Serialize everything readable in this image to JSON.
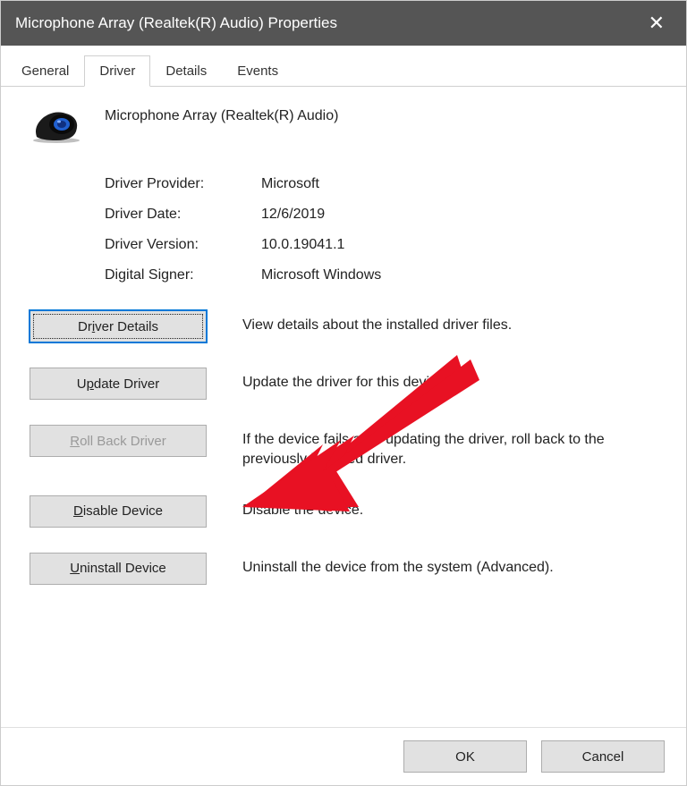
{
  "window": {
    "title": "Microphone Array (Realtek(R) Audio) Properties"
  },
  "tabs": [
    {
      "label": "General",
      "active": false
    },
    {
      "label": "Driver",
      "active": true
    },
    {
      "label": "Details",
      "active": false
    },
    {
      "label": "Events",
      "active": false
    }
  ],
  "device": {
    "name": "Microphone Array (Realtek(R) Audio)",
    "icon": "webcam-icon"
  },
  "info": {
    "provider_label": "Driver Provider:",
    "provider_value": "Microsoft",
    "date_label": "Driver Date:",
    "date_value": "12/6/2019",
    "version_label": "Driver Version:",
    "version_value": "10.0.19041.1",
    "signer_label": "Digital Signer:",
    "signer_value": "Microsoft Windows"
  },
  "actions": {
    "details": {
      "label_pre": "Dr",
      "label_mnemonic": "i",
      "label_post": "ver Details",
      "desc": "View details about the installed driver files."
    },
    "update": {
      "label_pre": "U",
      "label_mnemonic": "p",
      "label_post": "date Driver",
      "desc": "Update the driver for this device."
    },
    "rollback": {
      "label_pre": "",
      "label_mnemonic": "R",
      "label_post": "oll Back Driver",
      "desc": "If the device fails after updating the driver, roll back to the previously installed driver."
    },
    "disable": {
      "label_pre": "",
      "label_mnemonic": "D",
      "label_post": "isable Device",
      "desc": "Disable the device."
    },
    "uninstall": {
      "label_pre": "",
      "label_mnemonic": "U",
      "label_post": "ninstall Device",
      "desc": "Uninstall the device from the system (Advanced)."
    }
  },
  "buttons": {
    "ok": "OK",
    "cancel": "Cancel"
  },
  "annotation": {
    "arrow_color": "#e81123"
  }
}
